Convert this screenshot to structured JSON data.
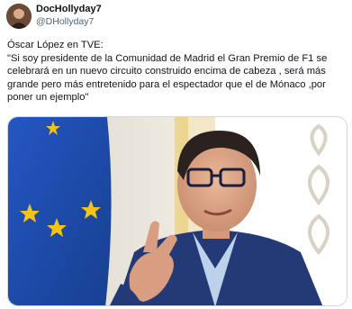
{
  "tweet": {
    "display_name": "DocHollyday7",
    "handle": "@DHollyday7",
    "text": "Óscar López en TVE:\n\"Si soy presidente de la Comunidad de Madrid el Gran Premio de F1 se celebrará en un nuevo circuito construido encima de cabeza , será más grande pero más entretenido para el espectador que el de Mónaco ,por poner un ejemplo\""
  },
  "media": {
    "type": "photo",
    "icon": "man-in-blue-suit-speaking-photo"
  },
  "colors": {
    "text_primary": "#0f1419",
    "text_secondary": "#536471",
    "border": "#cfd9de",
    "eu_flag_blue": "#1f4fb4",
    "eu_star_yellow": "#f2c418"
  }
}
